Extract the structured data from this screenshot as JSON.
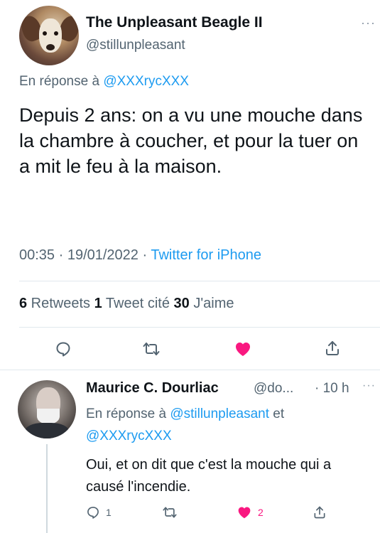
{
  "tweet": {
    "author_name": "The Unpleasant Beagle II",
    "author_handle": "@stillunpleasant",
    "more": "···",
    "reply_prefix": "En réponse à ",
    "reply_mention": "@XXXrycXXX",
    "text": "Depuis 2 ans: on a vu une mouche dans la chambre à coucher, et pour la tuer on a mit le feu à la maison.",
    "time": "00:35 · 19/01/2022 · ",
    "source": "Twitter for iPhone",
    "stats": {
      "retweets_count": "6",
      "retweets_label": " Retweets ",
      "quotes_count": "1",
      "quotes_label": " Tweet cité ",
      "likes_count": "30",
      "likes_label": " J'aime"
    },
    "liked": true,
    "icons": [
      "reply-icon",
      "retweet-icon",
      "like-icon",
      "share-icon"
    ]
  },
  "reply": {
    "author_name": "Maurice C. Dourliac",
    "author_handle": "@do...",
    "time": "· 10 h",
    "more": "···",
    "reply_prefix": "En réponse à ",
    "reply_mention_1": "@stillunpleasant",
    "reply_joiner": " et ",
    "reply_mention_2": "@XXXrycXXX",
    "text": "Oui, et on dit que c'est la mouche qui a causé l'incendie.",
    "reply_count": "1",
    "like_count": "2",
    "liked": true
  },
  "colors": {
    "accent": "#1d9bf0",
    "like": "#f91880",
    "secondary_text": "#536471",
    "primary_text": "#0f1419",
    "divider": "#e1e8ed"
  }
}
